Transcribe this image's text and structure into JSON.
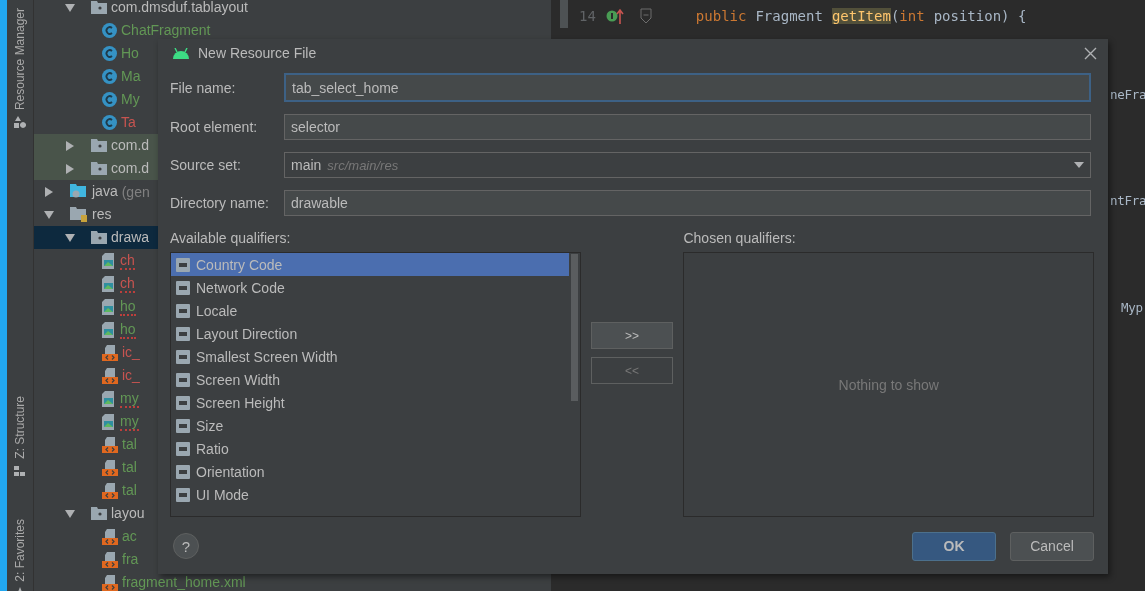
{
  "tool_strip": [
    {
      "label": "Resource Manager",
      "kind": "resources"
    },
    {
      "label": "Z: Structure",
      "kind": "structure"
    },
    {
      "label": "2: Favorites",
      "kind": "favorites"
    }
  ],
  "project_tree": [
    {
      "label": "com.dmsduf.tablayout",
      "kind": "package",
      "expanded": true,
      "selected": false,
      "highlighted": false,
      "children": [
        {
          "label": "ChatFragment",
          "kind": "class",
          "color": "#629755",
          "selected": false,
          "highlighted": false
        },
        {
          "label": "Ho",
          "kind": "class",
          "color": "#629755",
          "selected": false,
          "highlighted": false
        },
        {
          "label": "Ma",
          "kind": "class",
          "color": "#629755",
          "selected": false,
          "highlighted": false
        },
        {
          "label": "My",
          "kind": "class",
          "color": "#629755",
          "selected": false,
          "highlighted": false
        },
        {
          "label": "Ta",
          "kind": "class",
          "color": "#c75450",
          "selected": false,
          "highlighted": false
        }
      ]
    },
    {
      "label": "com.d",
      "kind": "package",
      "expanded": false,
      "selected": false,
      "highlighted": true
    },
    {
      "label": "com.d",
      "kind": "package",
      "expanded": false,
      "selected": false,
      "highlighted": true
    },
    {
      "label": "java",
      "note": "(gen",
      "kind": "java-folder",
      "expanded": false,
      "selected": false,
      "highlighted": false
    },
    {
      "label": "res",
      "kind": "res-folder",
      "expanded": true,
      "selected": false,
      "highlighted": false,
      "children": [
        {
          "label": "drawa",
          "kind": "folder",
          "expanded": true,
          "selected": true,
          "highlighted": false,
          "children": [
            {
              "label": "ch",
              "kind": "image",
              "color": "#c75450",
              "error": true,
              "selected": false,
              "highlighted": false
            },
            {
              "label": "ch",
              "kind": "image",
              "color": "#c75450",
              "error": true,
              "selected": false,
              "highlighted": false
            },
            {
              "label": "ho",
              "kind": "image",
              "color": "#629755",
              "error": true,
              "selected": false,
              "highlighted": false
            },
            {
              "label": "ho",
              "kind": "image",
              "color": "#629755",
              "error": true,
              "selected": false,
              "highlighted": false
            },
            {
              "label": "ic_",
              "kind": "xml",
              "color": "#c75450",
              "error": false,
              "selected": false,
              "highlighted": false
            },
            {
              "label": "ic_",
              "kind": "xml",
              "color": "#c75450",
              "error": false,
              "selected": false,
              "highlighted": false
            },
            {
              "label": "my",
              "kind": "image",
              "color": "#629755",
              "error": true,
              "selected": false,
              "highlighted": false
            },
            {
              "label": "my",
              "kind": "image",
              "color": "#629755",
              "error": true,
              "selected": false,
              "highlighted": false
            },
            {
              "label": "tal",
              "kind": "xml",
              "color": "#629755",
              "error": false,
              "selected": false,
              "highlighted": false
            },
            {
              "label": "tal",
              "kind": "xml",
              "color": "#629755",
              "error": false,
              "selected": false,
              "highlighted": false
            },
            {
              "label": "tal",
              "kind": "xml",
              "color": "#629755",
              "error": false,
              "selected": false,
              "highlighted": false
            }
          ]
        },
        {
          "label": "layou",
          "kind": "folder",
          "expanded": true,
          "selected": false,
          "highlighted": false,
          "children": [
            {
              "label": "ac",
              "kind": "xml",
              "color": "#629755",
              "error": false,
              "selected": false,
              "highlighted": false
            },
            {
              "label": "fra",
              "kind": "xml",
              "color": "#629755",
              "error": false,
              "selected": false,
              "highlighted": false
            },
            {
              "label": "fragment_home.xml",
              "kind": "xml",
              "color": "#629755",
              "error": false,
              "selected": false,
              "highlighted": false
            }
          ]
        }
      ]
    }
  ],
  "editor": {
    "line_number": "14",
    "code": [
      {
        "text": "public",
        "kind": "keyword"
      },
      {
        "text": "Fragment",
        "kind": "plain"
      },
      {
        "text": "getItem",
        "kind": "match"
      },
      {
        "text": "(",
        "kind": "plain"
      },
      {
        "text": "int",
        "kind": "keyword"
      },
      {
        "text": "position) {",
        "kind": "plain"
      }
    ],
    "fragments": [
      "neFra",
      "ntFra",
      "Myp"
    ]
  },
  "dialog": {
    "title": "New Resource File",
    "fields": [
      {
        "label": "File name:",
        "value": "tab_select_home",
        "kind": "text",
        "focused": true
      },
      {
        "label": "Root element:",
        "value": "selector",
        "kind": "text",
        "focused": false
      },
      {
        "label": "Source set:",
        "value": "main",
        "hint": "src/main/res",
        "kind": "dropdown",
        "focused": false
      },
      {
        "label": "Directory name:",
        "value": "drawable",
        "kind": "text",
        "focused": false
      }
    ],
    "available_label": "Available qualifiers:",
    "available": [
      {
        "label": "Country Code",
        "selected": true
      },
      {
        "label": "Network Code",
        "selected": false
      },
      {
        "label": "Locale",
        "selected": false
      },
      {
        "label": "Layout Direction",
        "selected": false
      },
      {
        "label": "Smallest Screen Width",
        "selected": false
      },
      {
        "label": "Screen Width",
        "selected": false
      },
      {
        "label": "Screen Height",
        "selected": false
      },
      {
        "label": "Size",
        "selected": false
      },
      {
        "label": "Ratio",
        "selected": false
      },
      {
        "label": "Orientation",
        "selected": false
      },
      {
        "label": "UI Mode",
        "selected": false
      }
    ],
    "chosen_label": "Chosen qualifiers:",
    "empty_text": "Nothing to show",
    "move_buttons": [
      {
        "label": ">>",
        "disabled": false
      },
      {
        "label": "<<",
        "disabled": true
      }
    ],
    "help": "?",
    "buttons": [
      {
        "label": "OK",
        "default": true
      },
      {
        "label": "Cancel",
        "default": false
      }
    ]
  }
}
